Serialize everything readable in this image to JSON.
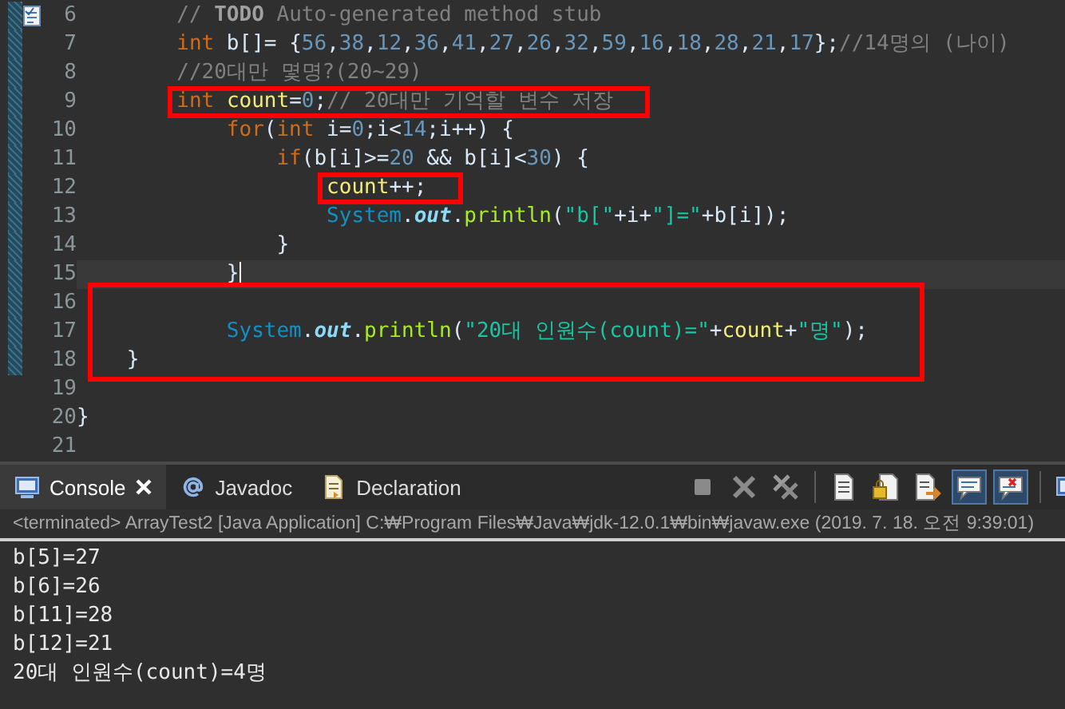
{
  "editor": {
    "lines": [
      {
        "number": "6",
        "changed": true,
        "task_marker": true,
        "tokens": [
          {
            "text": "        // ",
            "kind": "comment"
          },
          {
            "text": "TODO",
            "kind": "comment_tag"
          },
          {
            "text": " Auto-generated method stub",
            "kind": "comment"
          }
        ]
      },
      {
        "number": "7",
        "changed": true,
        "tokens": [
          {
            "text": "        int",
            "kind": "keyword"
          },
          {
            "text": " b[]= {",
            "kind": "plain"
          },
          {
            "text": "56",
            "kind": "number"
          },
          {
            "text": ",",
            "kind": "plain"
          },
          {
            "text": "38",
            "kind": "number"
          },
          {
            "text": ",",
            "kind": "plain"
          },
          {
            "text": "12",
            "kind": "number"
          },
          {
            "text": ",",
            "kind": "plain"
          },
          {
            "text": "36",
            "kind": "number"
          },
          {
            "text": ",",
            "kind": "plain"
          },
          {
            "text": "41",
            "kind": "number"
          },
          {
            "text": ",",
            "kind": "plain"
          },
          {
            "text": "27",
            "kind": "number"
          },
          {
            "text": ",",
            "kind": "plain"
          },
          {
            "text": "26",
            "kind": "number"
          },
          {
            "text": ",",
            "kind": "plain"
          },
          {
            "text": "32",
            "kind": "number"
          },
          {
            "text": ",",
            "kind": "plain"
          },
          {
            "text": "59",
            "kind": "number"
          },
          {
            "text": ",",
            "kind": "plain"
          },
          {
            "text": "16",
            "kind": "number"
          },
          {
            "text": ",",
            "kind": "plain"
          },
          {
            "text": "18",
            "kind": "number"
          },
          {
            "text": ",",
            "kind": "plain"
          },
          {
            "text": "28",
            "kind": "number"
          },
          {
            "text": ",",
            "kind": "plain"
          },
          {
            "text": "21",
            "kind": "number"
          },
          {
            "text": ",",
            "kind": "plain"
          },
          {
            "text": "17",
            "kind": "number"
          },
          {
            "text": "};",
            "kind": "plain"
          },
          {
            "text": "//14명의 (나이)",
            "kind": "comment"
          }
        ]
      },
      {
        "number": "8",
        "changed": true,
        "tokens": [
          {
            "text": "        //20대만 몇명?(20~29)",
            "kind": "comment"
          }
        ]
      },
      {
        "number": "9",
        "changed": true,
        "tokens": [
          {
            "text": "        int ",
            "kind": "keyword",
            "boxed": true
          },
          {
            "text": "count",
            "kind": "variable",
            "boxed": true
          },
          {
            "text": "=",
            "kind": "plain",
            "boxed": true
          },
          {
            "text": "0",
            "kind": "number",
            "boxed": true
          },
          {
            "text": ";",
            "kind": "plain",
            "boxed": true
          },
          {
            "text": "// 20대만 기억할 변수 저장",
            "kind": "comment",
            "boxed": true
          }
        ]
      },
      {
        "number": "10",
        "changed": true,
        "tokens": [
          {
            "text": "            for",
            "kind": "keyword"
          },
          {
            "text": "(",
            "kind": "plain"
          },
          {
            "text": "int",
            "kind": "keyword"
          },
          {
            "text": " i=",
            "kind": "plain"
          },
          {
            "text": "0",
            "kind": "number"
          },
          {
            "text": ";i<",
            "kind": "plain"
          },
          {
            "text": "14",
            "kind": "number"
          },
          {
            "text": ";i++) {",
            "kind": "plain"
          }
        ]
      },
      {
        "number": "11",
        "changed": true,
        "tokens": [
          {
            "text": "                if",
            "kind": "keyword"
          },
          {
            "text": "(b[i]>=",
            "kind": "plain"
          },
          {
            "text": "20",
            "kind": "number"
          },
          {
            "text": " && b[i]<",
            "kind": "plain"
          },
          {
            "text": "30",
            "kind": "number"
          },
          {
            "text": ") {",
            "kind": "plain"
          }
        ]
      },
      {
        "number": "12",
        "changed": true,
        "tokens": [
          {
            "text": "                    count",
            "kind": "variable",
            "boxed": true
          },
          {
            "text": "++;",
            "kind": "plain",
            "boxed": true
          }
        ]
      },
      {
        "number": "13",
        "changed": true,
        "tokens": [
          {
            "text": "                    System",
            "kind": "class"
          },
          {
            "text": ".",
            "kind": "plain"
          },
          {
            "text": "out",
            "kind": "static_field"
          },
          {
            "text": ".",
            "kind": "plain"
          },
          {
            "text": "println",
            "kind": "method"
          },
          {
            "text": "(",
            "kind": "plain"
          },
          {
            "text": "\"b[\"",
            "kind": "string"
          },
          {
            "text": "+i+",
            "kind": "plain"
          },
          {
            "text": "\"]=\"",
            "kind": "string"
          },
          {
            "text": "+b[i]);",
            "kind": "plain"
          }
        ]
      },
      {
        "number": "14",
        "changed": true,
        "tokens": [
          {
            "text": "                }",
            "kind": "plain"
          }
        ]
      },
      {
        "number": "15",
        "changed": true,
        "current": true,
        "tokens": [
          {
            "text": "            }",
            "kind": "plain"
          }
        ]
      },
      {
        "number": "16",
        "changed": true,
        "boxed": true
      },
      {
        "number": "17",
        "changed": true,
        "boxed": true,
        "tokens": [
          {
            "text": "            System",
            "kind": "class"
          },
          {
            "text": ".",
            "kind": "plain"
          },
          {
            "text": "out",
            "kind": "static_field"
          },
          {
            "text": ".",
            "kind": "plain"
          },
          {
            "text": "println",
            "kind": "method"
          },
          {
            "text": "(",
            "kind": "plain"
          },
          {
            "text": "\"20대 인원수(count)=\"",
            "kind": "string"
          },
          {
            "text": "+",
            "kind": "plain"
          },
          {
            "text": "count",
            "kind": "variable"
          },
          {
            "text": "+",
            "kind": "plain"
          },
          {
            "text": "\"명\"",
            "kind": "string"
          },
          {
            "text": ");",
            "kind": "plain"
          }
        ]
      },
      {
        "number": "18",
        "changed": true,
        "boxed": true,
        "tokens": [
          {
            "text": "    }",
            "kind": "plain"
          }
        ]
      },
      {
        "number": "19",
        "changed": false
      },
      {
        "number": "20",
        "changed": false,
        "tokens": [
          {
            "text": "}",
            "kind": "plain"
          }
        ]
      },
      {
        "number": "21",
        "changed": false
      }
    ]
  },
  "console": {
    "tabs": [
      {
        "label": "Console",
        "kind": "console",
        "selected": true,
        "closable": true
      },
      {
        "label": "Javadoc",
        "kind": "javadoc",
        "selected": false,
        "closable": false
      },
      {
        "label": "Declaration",
        "kind": "declaration",
        "selected": false,
        "closable": false
      }
    ],
    "toolbar": [
      {
        "kind": "stop",
        "pressed": false
      },
      {
        "kind": "remove",
        "pressed": false
      },
      {
        "kind": "remove_all",
        "pressed": false
      },
      {
        "kind": "separator"
      },
      {
        "kind": "clear",
        "pressed": false
      },
      {
        "kind": "scroll_lock",
        "pressed": false
      },
      {
        "kind": "word_wrap",
        "pressed": false
      },
      {
        "kind": "show_stdout",
        "pressed": true
      },
      {
        "kind": "show_stderr",
        "pressed": true
      },
      {
        "kind": "separator"
      },
      {
        "kind": "new_console",
        "pressed": false
      }
    ],
    "status": "<terminated> ArrayTest2 [Java Application] C:₩Program Files₩Java₩jdk-12.0.1₩bin₩javaw.exe (2019. 7. 18. 오전 9:39:01)",
    "output": [
      "b[5]=27",
      "b[6]=26",
      "b[11]=28",
      "b[12]=21",
      "20대 인원수(count)=4명"
    ]
  }
}
